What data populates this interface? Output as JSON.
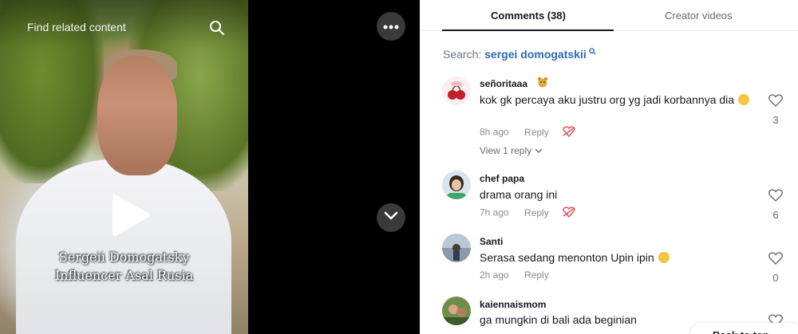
{
  "video": {
    "find_related": "Find related content",
    "caption_line1": "Sergeii Domogatsky",
    "caption_line2": "Influencer Asal Rusia"
  },
  "tabs": [
    {
      "label": "Comments (38)",
      "active": true
    },
    {
      "label": "Creator videos",
      "active": false
    }
  ],
  "search": {
    "prefix": "Search:",
    "term": "sergei domogatskii"
  },
  "comments": [
    {
      "username": "señoritaaa",
      "text": "kok gk percaya aku justru org yg jadi korbannya dia",
      "time": "8h ago",
      "reply": "Reply",
      "likes": "3",
      "view_replies": "View 1 reply"
    },
    {
      "username": "chef papa",
      "text": "drama orang ini",
      "time": "7h ago",
      "reply": "Reply",
      "likes": "6"
    },
    {
      "username": "Santi",
      "text": "Serasa sedang menonton Upin ipin",
      "time": "2h ago",
      "reply": "Reply",
      "likes": "0"
    },
    {
      "username": "kaiennaismom",
      "text": "ga mungkin di bali ada beginian"
    }
  ],
  "back_to_top": "Back to top",
  "colors": {
    "accent_blue": "#2b6cb0",
    "dislike_red": "#e5484d"
  }
}
